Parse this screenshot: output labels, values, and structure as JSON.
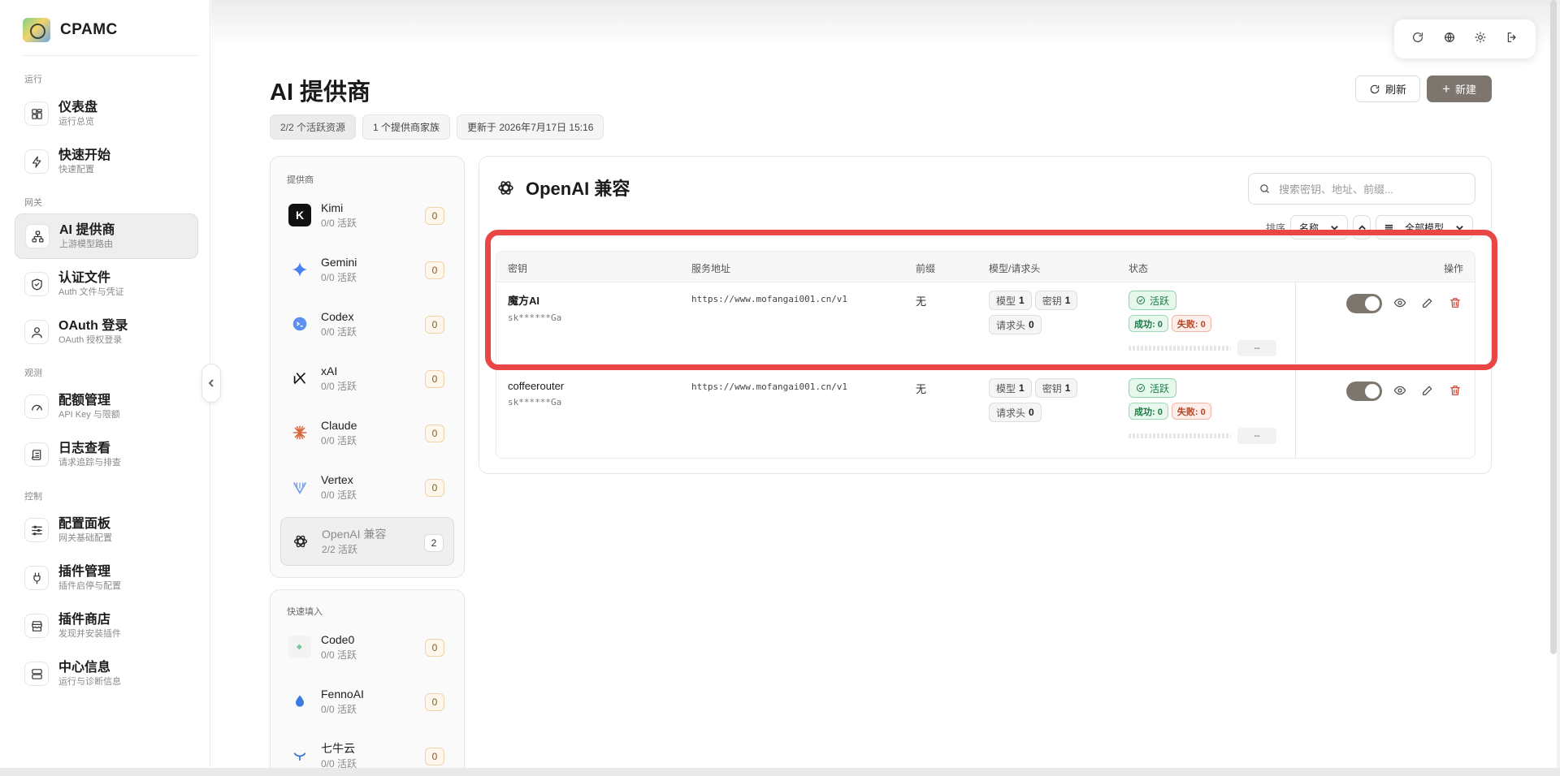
{
  "app": {
    "name": "CPAMC"
  },
  "sidebar": {
    "sections": [
      "运行",
      "网关",
      "观测",
      "控制"
    ],
    "items": [
      {
        "title": "仪表盘",
        "sub": "运行总览"
      },
      {
        "title": "快速开始",
        "sub": "快速配置"
      },
      {
        "title": "AI 提供商",
        "sub": "上游模型路由"
      },
      {
        "title": "认证文件",
        "sub": "Auth 文件与凭证"
      },
      {
        "title": "OAuth 登录",
        "sub": "OAuth 授权登录"
      },
      {
        "title": "配额管理",
        "sub": "API Key 与限额"
      },
      {
        "title": "日志查看",
        "sub": "请求追踪与排查"
      },
      {
        "title": "配置面板",
        "sub": "网关基础配置"
      },
      {
        "title": "插件管理",
        "sub": "插件启停与配置"
      },
      {
        "title": "插件商店",
        "sub": "发现并安装插件"
      },
      {
        "title": "中心信息",
        "sub": "运行与诊断信息"
      }
    ]
  },
  "header": {
    "title": "AI 提供商",
    "meta": [
      "2/2 个活跃资源",
      "1 个提供商家族",
      "更新于 2026年7月17日 15:16"
    ],
    "refresh_label": "刷新",
    "new_label": "新建"
  },
  "providers": {
    "label": "提供商",
    "items": [
      {
        "name": "Kimi",
        "sub": "0/0 活跃",
        "count": "0"
      },
      {
        "name": "Gemini",
        "sub": "0/0 活跃",
        "count": "0"
      },
      {
        "name": "Codex",
        "sub": "0/0 活跃",
        "count": "0"
      },
      {
        "name": "xAI",
        "sub": "0/0 活跃",
        "count": "0"
      },
      {
        "name": "Claude",
        "sub": "0/0 活跃",
        "count": "0"
      },
      {
        "name": "Vertex",
        "sub": "0/0 活跃",
        "count": "0"
      },
      {
        "name": "OpenAI 兼容",
        "sub": "2/2 活跃",
        "count": "2"
      }
    ]
  },
  "quick_fill": {
    "label": "快速填入",
    "items": [
      {
        "name": "Code0",
        "sub": "0/0 活跃",
        "count": "0"
      },
      {
        "name": "FennoAI",
        "sub": "0/0 活跃",
        "count": "0"
      },
      {
        "name": "七牛云",
        "sub": "0/0 活跃",
        "count": "0"
      }
    ]
  },
  "main": {
    "title": "OpenAI 兼容",
    "search_placeholder": "搜索密钥、地址、前缀...",
    "sort_label": "排序",
    "sort_value": "名称",
    "model_filter": "全部模型",
    "columns": [
      "密钥",
      "服务地址",
      "前缀",
      "模型/请求头",
      "状态",
      "操作"
    ],
    "rows": [
      {
        "name": "魔方AI",
        "key": "sk******Ga",
        "url": "https://www.mofangai001.cn/v1",
        "prefix": "无",
        "models_label": "模型",
        "models": "1",
        "keys_label": "密钥",
        "keys": "1",
        "headers_label": "请求头",
        "headers": "0",
        "status": "活跃",
        "success": "成功: 0",
        "fail": "失败: 0",
        "latency": "--"
      },
      {
        "name": "coffeerouter",
        "key": "sk******Ga",
        "url": "https://www.mofangai001.cn/v1",
        "prefix": "无",
        "models_label": "模型",
        "models": "1",
        "keys_label": "密钥",
        "keys": "1",
        "headers_label": "请求头",
        "headers": "0",
        "status": "活跃",
        "success": "成功: 0",
        "fail": "失败: 0",
        "latency": "--"
      }
    ]
  },
  "colors": {
    "accent": "#7d766f",
    "highlight": "#ea4646",
    "active_green": "#1a7a45",
    "fail_red": "#b04428"
  }
}
